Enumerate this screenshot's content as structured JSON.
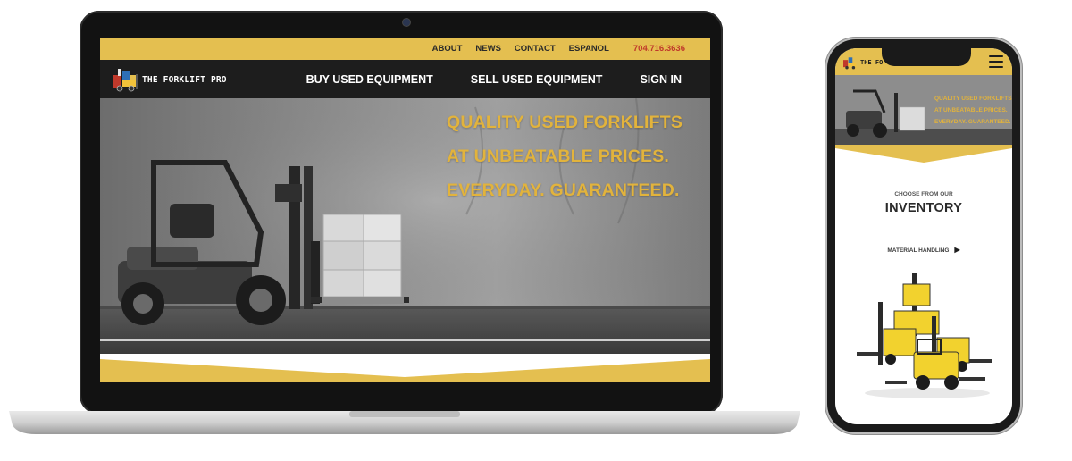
{
  "desktop": {
    "topnav": {
      "about": "ABOUT",
      "news": "NEWS",
      "contact": "CONTACT",
      "espanol": "ESPANOL",
      "phone": "704.716.3636"
    },
    "brand": "THE FORKLIFT PRO",
    "mainnav": {
      "buy": "BUY USED EQUIPMENT",
      "sell": "SELL USED EQUIPMENT",
      "signin": "SIGN IN"
    },
    "hero": {
      "line1": "QUALITY USED FORKLIFTS",
      "line2": "AT UNBEATABLE PRICES.",
      "line3": "EVERYDAY. GUARANTEED."
    }
  },
  "mobile": {
    "brand": "THE FO",
    "hero": {
      "line1": "QUALITY USED FORKLIFTS",
      "line2": "AT UNBEATABLE PRICES.",
      "line3": "EVERYDAY. GUARANTEED."
    },
    "choose": "CHOOSE FROM OUR",
    "inventory": "INVENTORY",
    "material": "MATERIAL HANDLING",
    "material_arrow": "▶"
  },
  "colors": {
    "accent": "#e4bf50",
    "headline": "#e2b33c",
    "navbar": "#1d1d1d",
    "phone_number": "#c0392b"
  },
  "icons": [
    "forklift-logo-icon",
    "hamburger-menu-icon",
    "triangle-right-icon"
  ]
}
